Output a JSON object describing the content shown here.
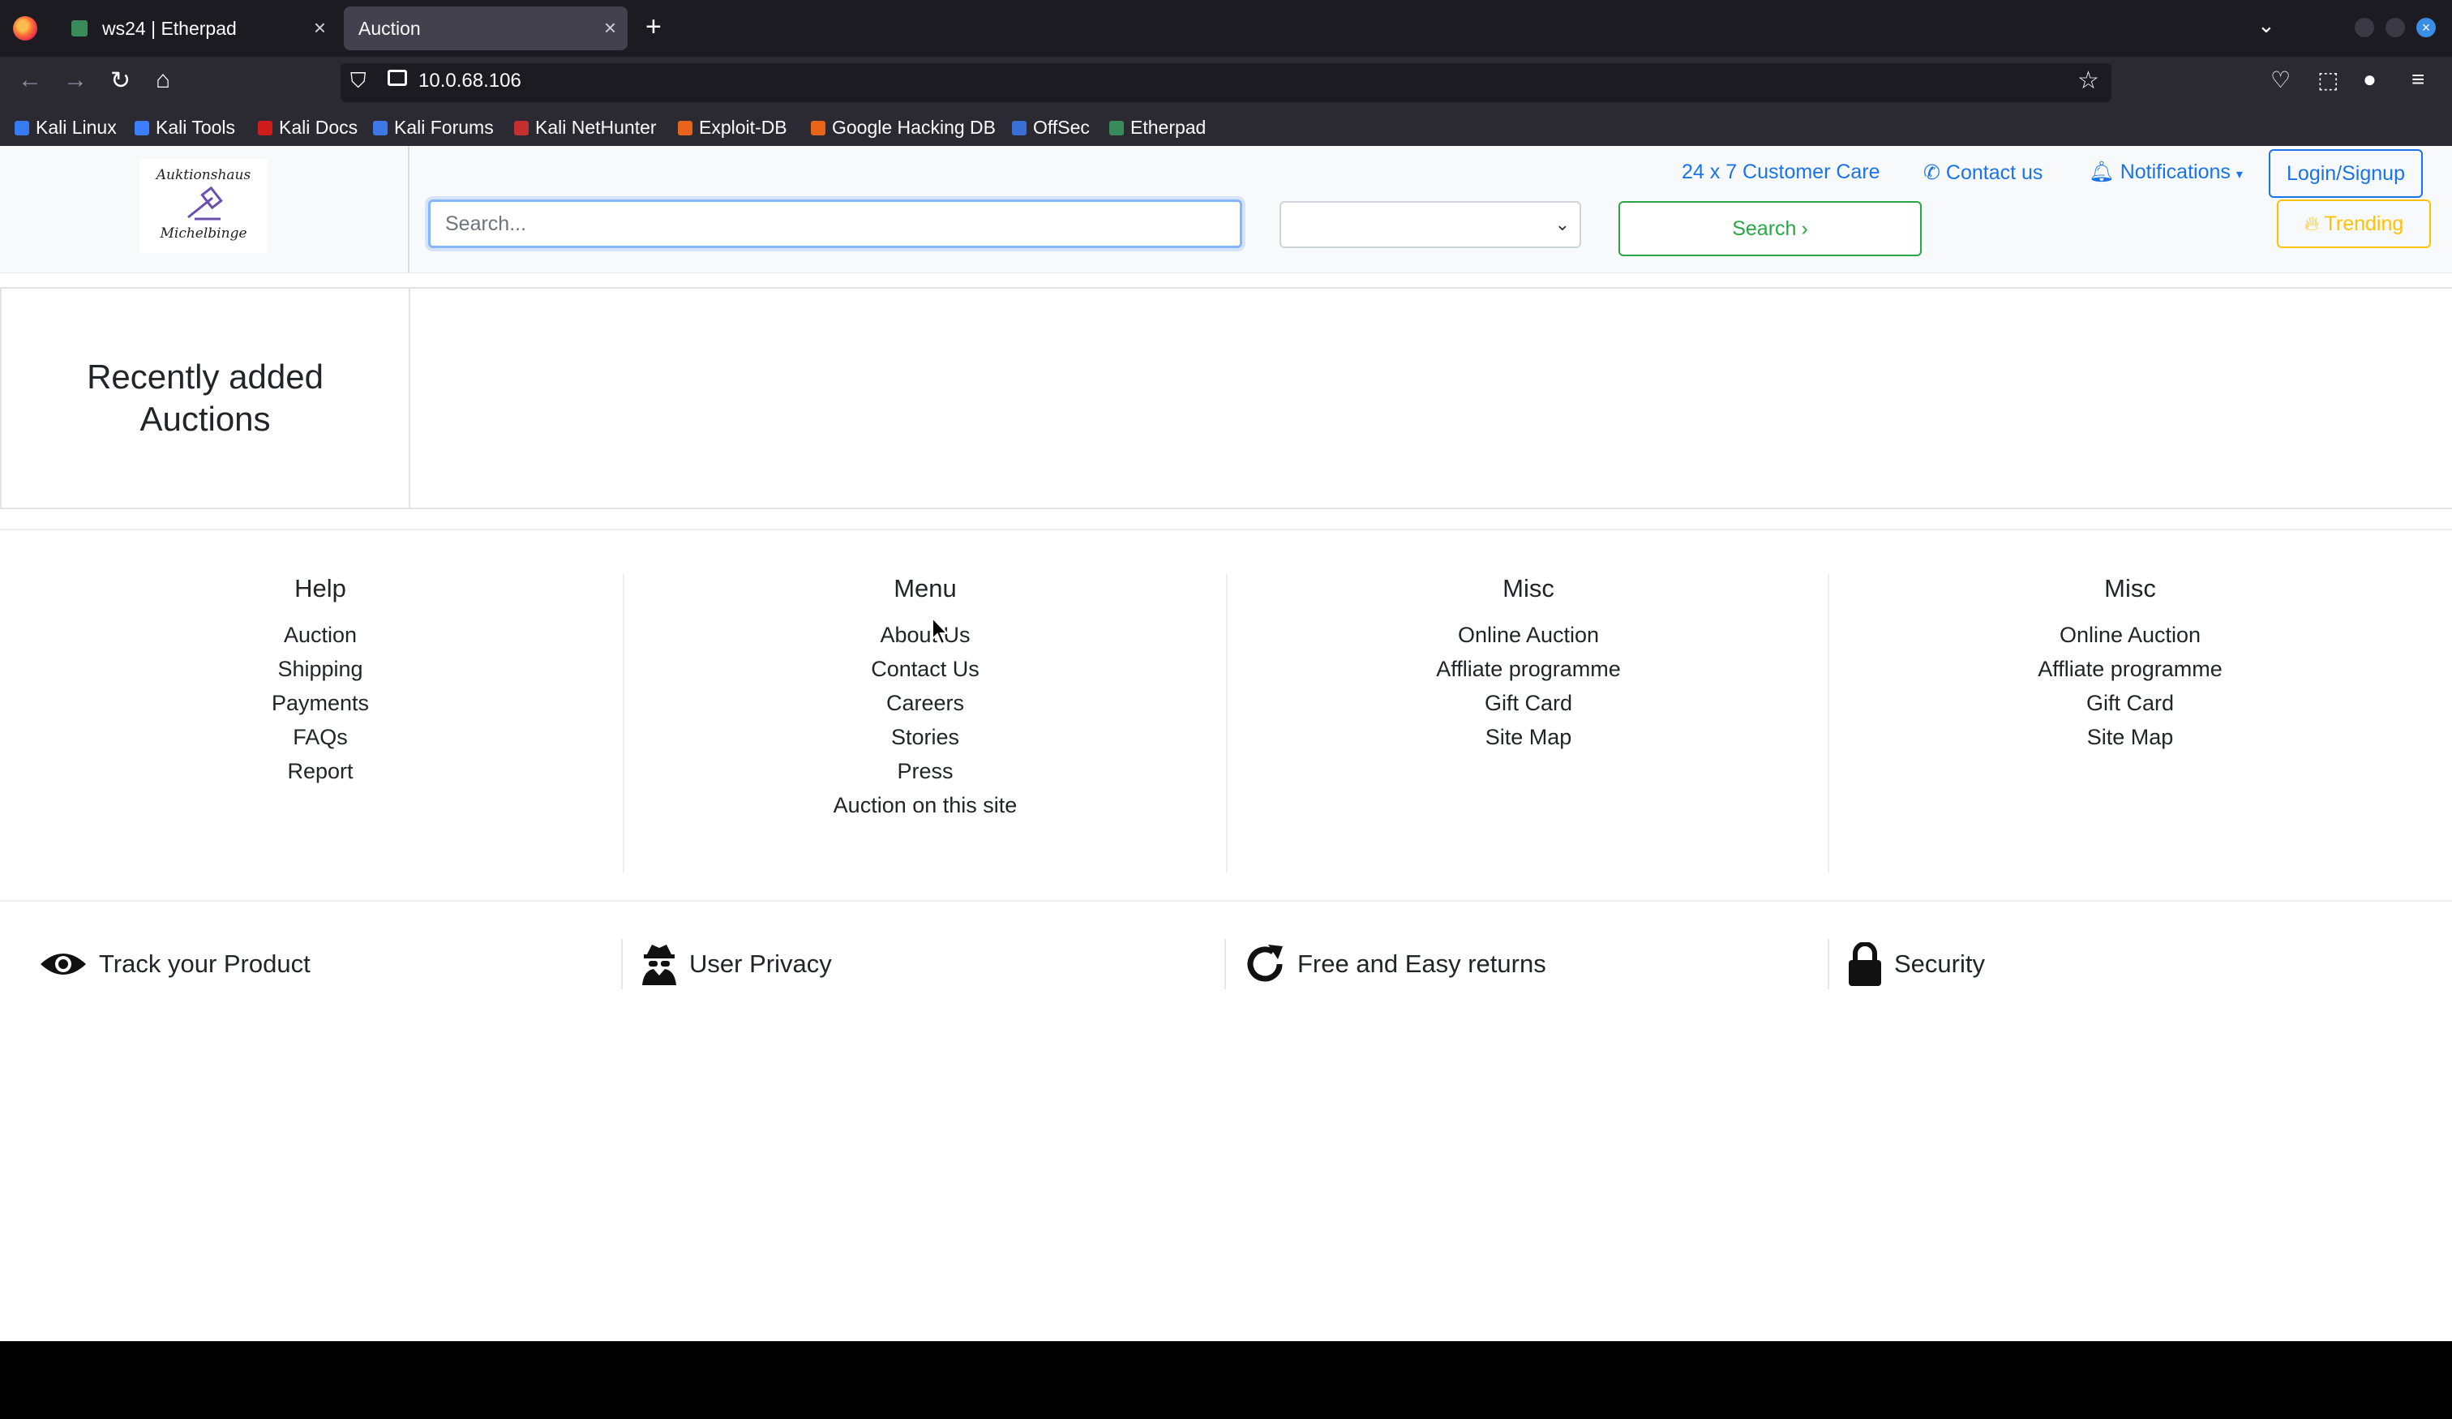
{
  "browser": {
    "tabs": [
      {
        "title": "ws24 | Etherpad",
        "active": false
      },
      {
        "title": "Auction",
        "active": true
      }
    ],
    "url": "10.0.68.106",
    "bookmarks": [
      {
        "label": "Kali Linux",
        "color": "#367bf0"
      },
      {
        "label": "Kali Tools",
        "color": "#3d7eff"
      },
      {
        "label": "Kali Docs",
        "color": "#d11c1c"
      },
      {
        "label": "Kali Forums",
        "color": "#3e77e6"
      },
      {
        "label": "Kali NetHunter",
        "color": "#c62f2f"
      },
      {
        "label": "Exploit-DB",
        "color": "#e8641b"
      },
      {
        "label": "Google Hacking DB",
        "color": "#e8641b"
      },
      {
        "label": "OffSec",
        "color": "#3b6fd8"
      },
      {
        "label": "Etherpad",
        "color": "#3a8b5c"
      }
    ]
  },
  "header": {
    "logo": {
      "line1": "Auktionshaus",
      "line2": "Michelbinge"
    },
    "search": {
      "placeholder": "Search...",
      "value": ""
    },
    "category_select": {
      "value": ""
    },
    "search_button": "Search",
    "customer_care": "24 x 7 Customer Care",
    "contact_us": "Contact us",
    "notifications": "Notifications",
    "login": "Login/Signup",
    "trending": "Trending"
  },
  "recent": {
    "title": "Recently added Auctions"
  },
  "footer": {
    "columns": [
      {
        "heading": "Help",
        "items": [
          "Auction",
          "Shipping",
          "Payments",
          "FAQs",
          "Report"
        ]
      },
      {
        "heading": "Menu",
        "items": [
          "About Us",
          "Contact Us",
          "Careers",
          "Stories",
          "Press",
          "Auction on this site"
        ]
      },
      {
        "heading": "Misc",
        "items": [
          "Online Auction",
          "Affliate programme",
          "Gift Card",
          "Site Map"
        ]
      },
      {
        "heading": "Misc",
        "items": [
          "Online Auction",
          "Affliate programme",
          "Gift Card",
          "Site Map"
        ]
      }
    ],
    "features": [
      {
        "label": "Track your Product",
        "icon": "eye-icon"
      },
      {
        "label": "User Privacy",
        "icon": "user-secret-icon"
      },
      {
        "label": "Free and Easy returns",
        "icon": "refresh-icon"
      },
      {
        "label": "Security",
        "icon": "lock-icon"
      }
    ]
  },
  "colors": {
    "link_blue": "#1a73e8",
    "search_green": "#28a745",
    "trending_yellow": "#ffc107",
    "focus_blue": "#86b7fe"
  }
}
